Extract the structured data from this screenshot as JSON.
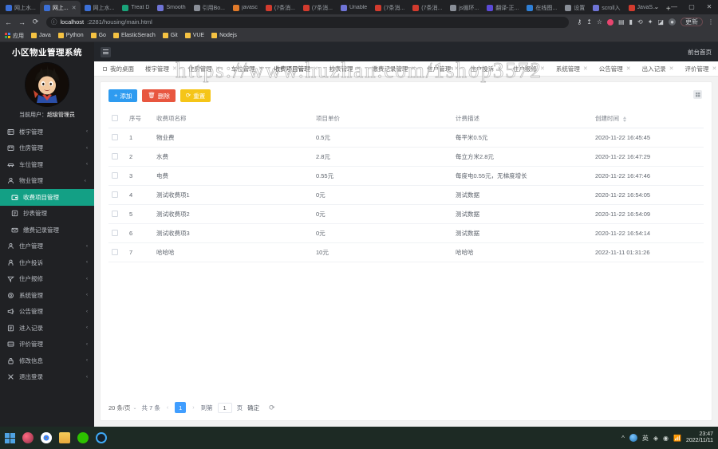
{
  "browser": {
    "tabs": [
      {
        "title": "网上水...",
        "active": false
      },
      {
        "title": "网上...",
        "active": true
      },
      {
        "title": "网上水...",
        "active": false
      },
      {
        "title": "Treat D",
        "active": false
      },
      {
        "title": "Smooth",
        "active": false
      },
      {
        "title": "引用Bo...",
        "active": false
      },
      {
        "title": "javasc",
        "active": false
      },
      {
        "title": "(7条消...",
        "active": false
      },
      {
        "title": "(7条消...",
        "active": false
      },
      {
        "title": "Unable",
        "active": false
      },
      {
        "title": "(7条消...",
        "active": false
      },
      {
        "title": "(7条消...",
        "active": false
      },
      {
        "title": "js循环...",
        "active": false
      },
      {
        "title": "翻译-正...",
        "active": false
      },
      {
        "title": "在线图...",
        "active": false
      },
      {
        "title": "设置",
        "active": false
      },
      {
        "title": "scroll入",
        "active": false
      },
      {
        "title": "JavaS...",
        "active": false
      }
    ],
    "new_tab_label": "+",
    "window_controls": [
      "⌄",
      "—",
      "▢",
      "✕"
    ],
    "nav": {
      "back": "←",
      "forward": "→",
      "reload": "⟳"
    },
    "address": {
      "host": "localhost",
      "path": ":2281/housing/main.html",
      "info_icon": "ⓘ"
    },
    "toolbar_icons": [
      "key-icon",
      "share-icon",
      "star-icon",
      "extension-red-icon",
      "clipboard-icon",
      "battery-icon",
      "sync-icon",
      "puzzle-icon",
      "sidepanel-icon",
      "profile-icon"
    ],
    "update_label": "更新",
    "menu_label": "⋮",
    "bookmarks": [
      {
        "label": "应用",
        "type": "apps"
      },
      {
        "label": "Java",
        "type": "folder"
      },
      {
        "label": "Python",
        "type": "folder"
      },
      {
        "label": "Go",
        "type": "folder"
      },
      {
        "label": "ElasticSerach",
        "type": "folder"
      },
      {
        "label": "Git",
        "type": "folder"
      },
      {
        "label": "VUE",
        "type": "folder"
      },
      {
        "label": "Nodejs",
        "type": "folder"
      }
    ]
  },
  "sidebar": {
    "brand": "小区物业管理系统",
    "current_user_label": "当前用户：",
    "current_user_name": "超级管理员",
    "items": [
      {
        "label": "楼宇管理",
        "icon": "building-icon",
        "chevron": "‹",
        "state": "collapsed"
      },
      {
        "label": "住房管理",
        "icon": "house-icon",
        "chevron": "‹",
        "state": "collapsed"
      },
      {
        "label": "车位管理",
        "icon": "car-icon",
        "chevron": "‹",
        "state": "collapsed"
      },
      {
        "label": "物业管理",
        "icon": "users-icon",
        "chevron": "⌄",
        "state": "expanded"
      },
      {
        "label": "收费项目管理",
        "icon": "wallet-icon",
        "chevron": "",
        "state": "active-sub"
      },
      {
        "label": "抄表管理",
        "icon": "meter-icon",
        "chevron": "",
        "state": "sub"
      },
      {
        "label": "缴费记录管理",
        "icon": "receipt-icon",
        "chevron": "",
        "state": "sub"
      },
      {
        "label": "住户管理",
        "icon": "user-icon",
        "chevron": "‹",
        "state": "collapsed"
      },
      {
        "label": "住户投诉",
        "icon": "person-icon",
        "chevron": "‹",
        "state": "collapsed"
      },
      {
        "label": "住户报修",
        "icon": "wrench-icon",
        "chevron": "‹",
        "state": "collapsed"
      },
      {
        "label": "系统管理",
        "icon": "gear-icon",
        "chevron": "‹",
        "state": "collapsed"
      },
      {
        "label": "公告管理",
        "icon": "megaphone-icon",
        "chevron": "‹",
        "state": "collapsed"
      },
      {
        "label": "进入记录",
        "icon": "log-icon",
        "chevron": "‹",
        "state": "collapsed"
      },
      {
        "label": "评价管理",
        "icon": "comment-icon",
        "chevron": "‹",
        "state": "collapsed"
      },
      {
        "label": "修改信息",
        "icon": "lock-icon",
        "chevron": "‹",
        "state": "collapsed"
      },
      {
        "label": "退出登录",
        "icon": "close-icon",
        "chevron": "‹",
        "state": "collapsed"
      }
    ]
  },
  "topbar": {
    "menu_toggle": "hamburger-icon",
    "front_link": "前台首页"
  },
  "tabs": [
    {
      "label": "我的桌面",
      "closable": false,
      "active": false
    },
    {
      "label": "楼宇管理",
      "closable": true,
      "active": false
    },
    {
      "label": "住房管理",
      "closable": true,
      "active": false
    },
    {
      "label": "车位管理",
      "closable": true,
      "active": false
    },
    {
      "label": "收费项目管理",
      "closable": true,
      "active": true
    },
    {
      "label": "抄表管理",
      "closable": true,
      "active": false
    },
    {
      "label": "缴费记录管理",
      "closable": true,
      "active": false
    },
    {
      "label": "住户管理",
      "closable": true,
      "active": false
    },
    {
      "label": "住户投诉",
      "closable": true,
      "active": false
    },
    {
      "label": "住户报修",
      "closable": true,
      "active": false
    },
    {
      "label": "系统管理",
      "closable": true,
      "active": false
    },
    {
      "label": "公告管理",
      "closable": true,
      "active": false
    },
    {
      "label": "出入记录",
      "closable": true,
      "active": false
    },
    {
      "label": "评价管理",
      "closable": true,
      "active": false
    }
  ],
  "tabs_more": "⌄",
  "toolbar": {
    "add_label": "添加",
    "add_glyph": "+",
    "delete_label": "删除",
    "delete_glyph": "🗑",
    "reset_label": "重置",
    "reset_glyph": "⟳",
    "columns_icon": "columns-settings-icon"
  },
  "table": {
    "headers": [
      "序号",
      "收费项名称",
      "项目单价",
      "计费描述",
      "创建时间"
    ],
    "sortable_header": "创建时间",
    "rows": [
      {
        "idx": "1",
        "name": "物业费",
        "price": "0.5元",
        "desc": "每平米0.5元",
        "created": "2020-11-22 16:45:45"
      },
      {
        "idx": "2",
        "name": "水费",
        "price": "2.8元",
        "desc": "每立方米2.8元",
        "created": "2020-11-22 16:47:29"
      },
      {
        "idx": "3",
        "name": "电费",
        "price": "0.55元",
        "desc": "每度电0.55元，无梯度增长",
        "created": "2020-11-22 16:47:46"
      },
      {
        "idx": "4",
        "name": "测试收费项1",
        "price": "0元",
        "desc": "测试数据",
        "created": "2020-11-22 16:54:05"
      },
      {
        "idx": "5",
        "name": "测试收费项2",
        "price": "0元",
        "desc": "测试数据",
        "created": "2020-11-22 16:54:09"
      },
      {
        "idx": "6",
        "name": "测试收费项3",
        "price": "0元",
        "desc": "测试数据",
        "created": "2020-11-22 16:54:14"
      },
      {
        "idx": "7",
        "name": "哈哈哈",
        "price": "10元",
        "desc": "哈哈哈",
        "created": "2022-11-11 01:31:26"
      }
    ]
  },
  "pager": {
    "page_size": "20 条/页",
    "page_size_caret": "⌄",
    "total": "共 7 条",
    "prev": "‹",
    "next": "›",
    "current_page": "1",
    "goto_label": "到第",
    "goto_value": "1",
    "page_unit": "页",
    "confirm": "确定",
    "refresh_icon": "refresh-icon"
  },
  "watermark": "https://www.huzhan.com/1shop3572",
  "taskbar": {
    "start": "windows-start-icon",
    "apps": [
      "rose-app-icon",
      "chrome-icon",
      "file-explorer-icon",
      "wechat-icon",
      "ring-app-icon"
    ],
    "tray_glyphs": [
      "^",
      "globe-icon",
      "英",
      "◈",
      "◉",
      "📶"
    ],
    "time": "23:47",
    "date": "2022/11/11"
  },
  "colors": {
    "sidebar_bg": "#202124",
    "active_menu": "#13a085",
    "primary_blue": "#2e9bf0",
    "danger_red": "#e8563f",
    "warning_yellow": "#f5c518",
    "pager_active": "#409eff"
  }
}
